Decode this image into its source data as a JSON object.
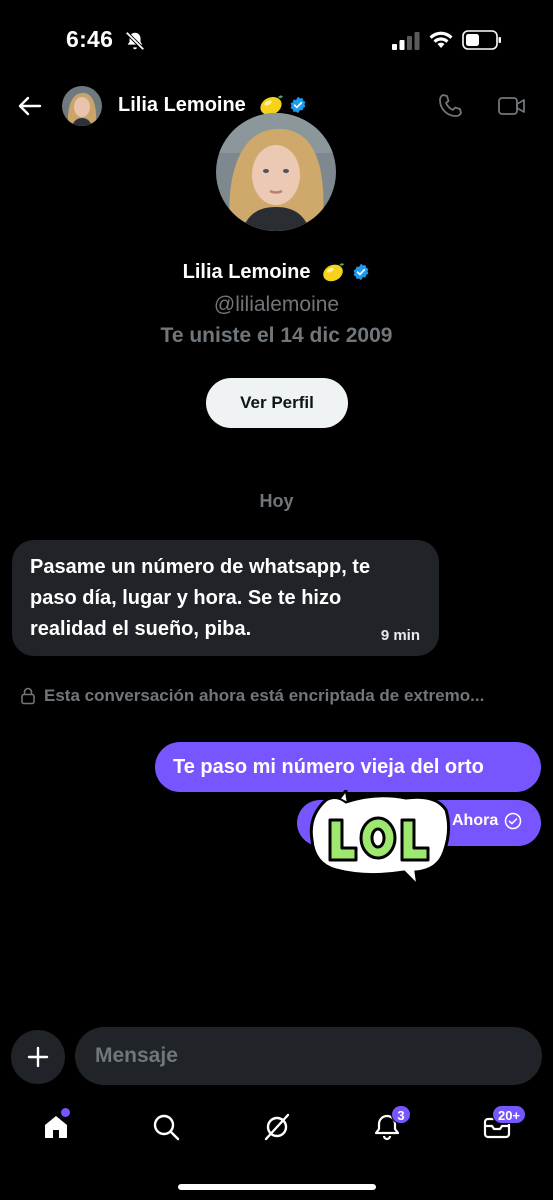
{
  "status_bar": {
    "time": "6:46"
  },
  "header": {
    "name": "Lilia Lemoine",
    "emoji_icon": "lemon-icon"
  },
  "profile": {
    "name": "Lilia Lemoine",
    "handle": "@lilialemoine",
    "joined": "Te uniste el 14 dic 2009",
    "view_profile_label": "Ver Perfil"
  },
  "conversation": {
    "date_separator": "Hoy",
    "messages": [
      {
        "direction": "incoming",
        "text": "Pasame un número de whatsapp, te paso día, lugar y hora. Se te hizo realidad el sueño, piba.",
        "time": "9 min"
      },
      {
        "direction": "outgoing",
        "text": "Te paso mi número vieja del orto"
      },
      {
        "direction": "outgoing",
        "sticker": "LOL",
        "time": "Ahora"
      }
    ],
    "encryption_notice": "Esta conversación ahora está encriptada de extremo..."
  },
  "composer": {
    "placeholder": "Mensaje"
  },
  "nav": {
    "notifications_badge": "3",
    "messages_badge": "20+"
  },
  "colors": {
    "accent": "#7856ff",
    "verified": "#1d9bf0",
    "bubble_in": "#202327"
  }
}
